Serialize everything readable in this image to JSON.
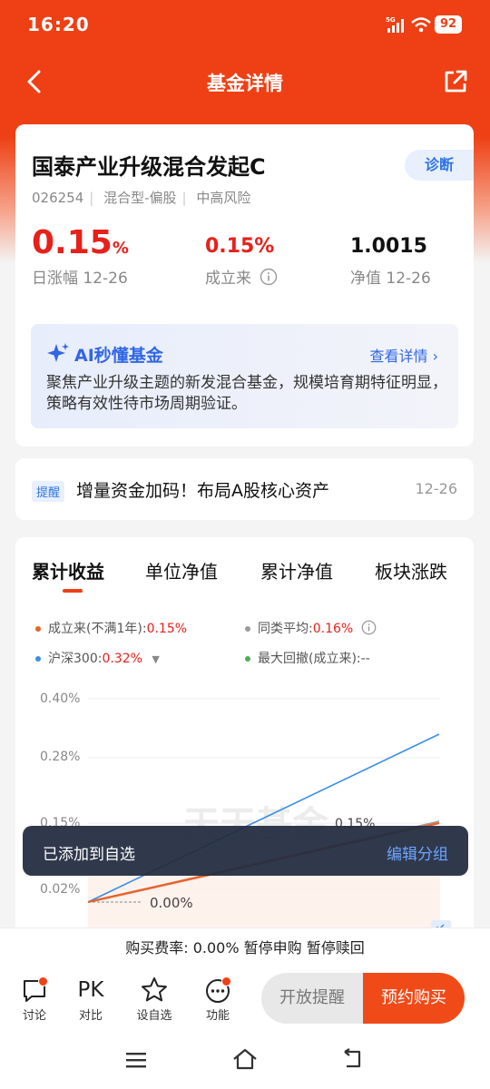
{
  "status": {
    "time": "16:20",
    "network": "5G",
    "battery": "92"
  },
  "nav": {
    "title": "基金详情"
  },
  "fund": {
    "name": "国泰产业升级混合发起C",
    "diagnose": "诊断",
    "code": "026254",
    "type": "混合型-偏股",
    "risk": "中高风险",
    "daily_change_value": "0.15",
    "daily_change_unit": "%",
    "daily_change_label": "日涨幅 12-26",
    "since_inception_value": "0.15%",
    "since_inception_label": "成立来",
    "nav_value": "1.0015",
    "nav_label": "净值 12-26"
  },
  "ai": {
    "title": "AI秒懂基金",
    "more": "查看详情",
    "text": "聚焦产业升级主题的新发混合基金，规模培育期特征明显，策略有效性待市场周期验证。"
  },
  "notice": {
    "tag": "提醒",
    "text": "增量资金加码！布局A股核心资产",
    "date": "12-26"
  },
  "chart_tabs": [
    "累计收益",
    "单位净值",
    "累计净值",
    "板块涨跌"
  ],
  "legend": {
    "fund_label": "成立来(不满1年):",
    "fund_value": "0.15%",
    "peer_label": "同类平均:",
    "peer_value": "0.16%",
    "index_label": "沪深300:",
    "index_value": "0.32%",
    "drawdown_label": "最大回撤(成立来):",
    "drawdown_value": "--"
  },
  "colors": {
    "fund": "#e8622a",
    "peer": "#999999",
    "index": "#3a8ee6",
    "drawdown": "#4caf50",
    "accent": "#ee4014"
  },
  "chart_data": {
    "type": "line",
    "y_ticks": [
      "0.40%",
      "0.28%",
      "0.15%",
      "0.02%"
    ],
    "ylim": [
      0.02,
      0.4
    ],
    "series": [
      {
        "name": "沪深300",
        "values": [
          0.0,
          0.32
        ]
      },
      {
        "name": "同类平均",
        "values": [
          0.0,
          0.16
        ]
      },
      {
        "name": "成立来",
        "values": [
          0.0,
          0.15
        ]
      }
    ],
    "annotations": [
      "0.15%",
      "0.00%"
    ],
    "watermark": "天天基金"
  },
  "toast": {
    "message": "已添加到自选",
    "action": "编辑分组"
  },
  "fee_text": "购买费率: 0.00% 暂停申购 暂停赎回",
  "bottom": {
    "items": [
      "讨论",
      "对比",
      "设自选",
      "功能"
    ],
    "pk": "PK",
    "remind": "开放提醒",
    "buy": "预约购买"
  }
}
